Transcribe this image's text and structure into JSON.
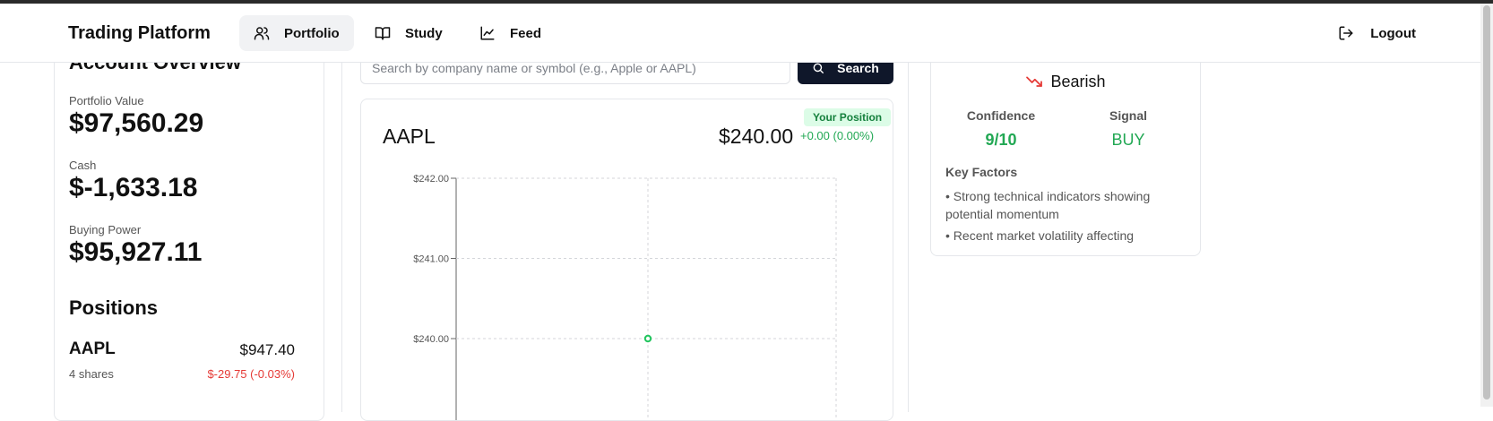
{
  "app": {
    "title": "Trading Platform"
  },
  "nav": {
    "items": [
      {
        "label": "Portfolio",
        "icon": "users-icon",
        "active": true
      },
      {
        "label": "Study",
        "icon": "book-open-icon",
        "active": false
      },
      {
        "label": "Feed",
        "icon": "line-chart-icon",
        "active": false
      }
    ],
    "logout_label": "Logout"
  },
  "account": {
    "title": "Account Overview",
    "portfolio_value_label": "Portfolio Value",
    "portfolio_value": "$97,560.29",
    "cash_label": "Cash",
    "cash": "$-1,633.18",
    "buying_power_label": "Buying Power",
    "buying_power": "$95,927.11"
  },
  "positions": {
    "title": "Positions",
    "items": [
      {
        "symbol": "AAPL",
        "value": "$947.40",
        "shares": "4 shares",
        "change": "$-29.75 (-0.03%)"
      }
    ]
  },
  "search": {
    "placeholder": "Search by company name or symbol (e.g., Apple or AAPL)",
    "value": "",
    "button_label": "Search"
  },
  "stock": {
    "symbol": "AAPL",
    "price": "$240.00",
    "change": "+0.00 (0.00%)",
    "badge": "Your Position"
  },
  "chart_data": {
    "type": "line",
    "title": "",
    "xlabel": "",
    "ylabel": "",
    "y_ticks": [
      "$242.00",
      "$241.00",
      "$240.00"
    ],
    "ylim": [
      239.5,
      242
    ],
    "series": [
      {
        "values": [
          240.0
        ]
      }
    ],
    "grid": true,
    "line_color": "#22c55e"
  },
  "analysis": {
    "sentiment": "Bearish",
    "sentiment_icon": "trending-down-icon",
    "confidence_label": "Confidence",
    "confidence": "9/10",
    "signal_label": "Signal",
    "signal": "BUY",
    "key_factors_title": "Key Factors",
    "key_factors": [
      "• Strong technical indicators showing potential momentum",
      "• Recent market volatility affecting"
    ]
  },
  "colors": {
    "positive": "#22a854",
    "negative": "#e53935",
    "primary_button": "#0f172a",
    "badge_bg": "#dcfce7"
  }
}
